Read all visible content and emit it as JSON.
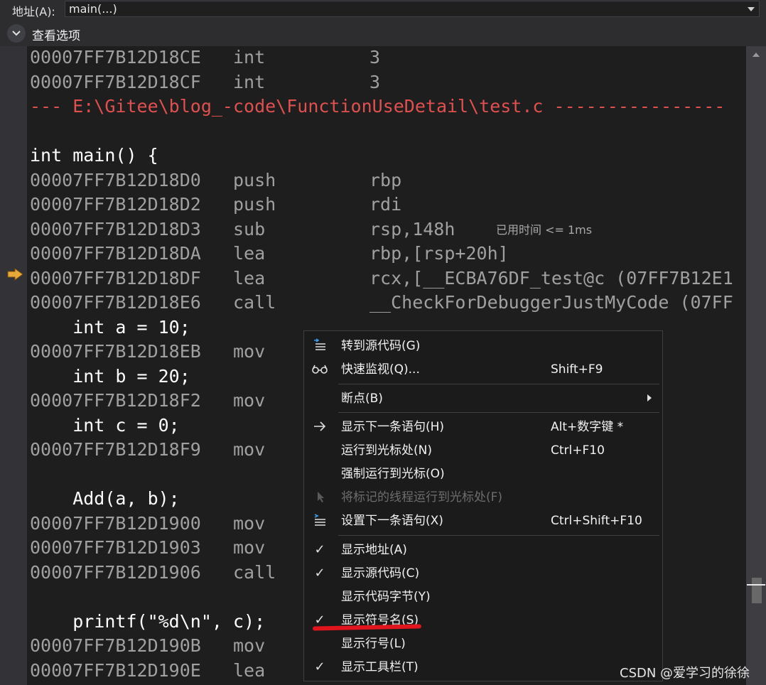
{
  "address_bar": {
    "label": "地址(A):",
    "value": "main(...)"
  },
  "view_options": {
    "label": "查看选项"
  },
  "disassembly": [
    {
      "kind": "asm",
      "addr": "00007FF7B12D18CE",
      "mnemonic": "int",
      "operand": "3"
    },
    {
      "kind": "asm",
      "addr": "00007FF7B12D18CF",
      "mnemonic": "int",
      "operand": "3"
    },
    {
      "kind": "file",
      "text": "--- E:\\Gitee\\blog_-code\\FunctionUseDetail\\test.c ----------------"
    },
    {
      "kind": "blank",
      "text": ""
    },
    {
      "kind": "source",
      "text": "int main() {"
    },
    {
      "kind": "asm",
      "addr": "00007FF7B12D18D0",
      "mnemonic": "push",
      "operand": "rbp"
    },
    {
      "kind": "asm",
      "addr": "00007FF7B12D18D2",
      "mnemonic": "push",
      "operand": "rdi"
    },
    {
      "kind": "asm",
      "addr": "00007FF7B12D18D3",
      "mnemonic": "sub",
      "operand": "rsp,148h",
      "note": "已用时间 <= 1ms"
    },
    {
      "kind": "asm",
      "addr": "00007FF7B12D18DA",
      "mnemonic": "lea",
      "operand": "rbp,[rsp+20h]"
    },
    {
      "kind": "asm",
      "addr": "00007FF7B12D18DF",
      "mnemonic": "lea",
      "operand": "rcx,[__ECBA76DF_test@c (07FF7B12E1"
    },
    {
      "kind": "asm",
      "addr": "00007FF7B12D18E6",
      "mnemonic": "call",
      "operand": "__CheckForDebuggerJustMyCode (07FF"
    },
    {
      "kind": "source",
      "text": "    int a = 10;"
    },
    {
      "kind": "asm",
      "addr": "00007FF7B12D18EB",
      "mnemonic": "mov",
      "operand": ""
    },
    {
      "kind": "source",
      "text": "    int b = 20;"
    },
    {
      "kind": "asm",
      "addr": "00007FF7B12D18F2",
      "mnemonic": "mov",
      "operand": ""
    },
    {
      "kind": "source",
      "text": "    int c = 0;"
    },
    {
      "kind": "asm",
      "addr": "00007FF7B12D18F9",
      "mnemonic": "mov",
      "operand": ""
    },
    {
      "kind": "blank",
      "text": ""
    },
    {
      "kind": "source",
      "text": "    Add(a, b);"
    },
    {
      "kind": "asm",
      "addr": "00007FF7B12D1900",
      "mnemonic": "mov",
      "operand": ""
    },
    {
      "kind": "asm",
      "addr": "00007FF7B12D1903",
      "mnemonic": "mov",
      "operand": ""
    },
    {
      "kind": "asm",
      "addr": "00007FF7B12D1906",
      "mnemonic": "call",
      "operand": ""
    },
    {
      "kind": "blank",
      "text": ""
    },
    {
      "kind": "source",
      "text": "    printf(\"%d\\n\", c);"
    },
    {
      "kind": "asm",
      "addr": "00007FF7B12D190B",
      "mnemonic": "mov",
      "operand": ""
    },
    {
      "kind": "asm",
      "addr": "00007FF7B12D190E",
      "mnemonic": "lea",
      "operand": ""
    }
  ],
  "context_menu": {
    "items": [
      {
        "id": "goto-source",
        "label": "转到源代码(G)",
        "shortcut": "",
        "icon": "goto-source-icon",
        "disabled": false
      },
      {
        "id": "quick-watch",
        "label": "快速监视(Q)...",
        "shortcut": "Shift+F9",
        "icon": "glasses-icon",
        "disabled": false
      },
      {
        "id": "breakpoint",
        "label": "断点(B)",
        "shortcut": "",
        "icon": "",
        "submenu": true,
        "disabled": false
      },
      {
        "id": "show-next-statement",
        "label": "显示下一条语句(H)",
        "shortcut": "Alt+数字键 *",
        "icon": "arrow-right-icon",
        "disabled": false
      },
      {
        "id": "run-to-cursor",
        "label": "运行到光标处(N)",
        "shortcut": "Ctrl+F10",
        "icon": "",
        "disabled": false
      },
      {
        "id": "force-run-to-cursor",
        "label": "强制运行到光标(O)",
        "shortcut": "",
        "icon": "",
        "disabled": false
      },
      {
        "id": "run-flagged-threads",
        "label": "将标记的线程运行到光标处(F)",
        "shortcut": "",
        "icon": "cursor-icon",
        "disabled": true
      },
      {
        "id": "set-next-statement",
        "label": "设置下一条语句(X)",
        "shortcut": "Ctrl+Shift+F10",
        "icon": "set-next-statement-icon",
        "disabled": false
      },
      {
        "id": "show-address",
        "label": "显示地址(A)",
        "shortcut": "",
        "icon": "check-icon",
        "checked": true,
        "disabled": false
      },
      {
        "id": "show-source",
        "label": "显示源代码(C)",
        "shortcut": "",
        "icon": "check-icon",
        "checked": true,
        "disabled": false
      },
      {
        "id": "show-code-bytes",
        "label": "显示代码字节(Y)",
        "shortcut": "",
        "icon": "",
        "checked": false,
        "disabled": false
      },
      {
        "id": "show-symbol-names",
        "label": "显示符号名(S)",
        "shortcut": "",
        "icon": "check-icon",
        "checked": true,
        "disabled": false
      },
      {
        "id": "show-line-numbers",
        "label": "显示行号(L)",
        "shortcut": "",
        "icon": "",
        "checked": false,
        "disabled": false
      },
      {
        "id": "show-toolbar",
        "label": "显示工具栏(T)",
        "shortcut": "",
        "icon": "check-icon",
        "checked": true,
        "disabled": false
      }
    ]
  },
  "watermark": "CSDN @爱学习的徐徐",
  "colors": {
    "background": "#1e1e1e",
    "file_header": "#e05050",
    "ip_arrow": "#e8a93a",
    "annotation_underline": "#e0151d"
  }
}
